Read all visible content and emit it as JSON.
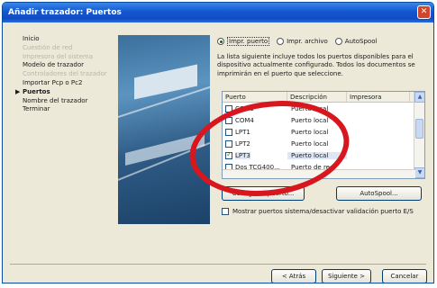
{
  "window": {
    "title": "Añadir trazador: Puertos",
    "close_glyph": "✕"
  },
  "steps": [
    {
      "label": "Inicio",
      "state": "normal"
    },
    {
      "label": "Cuestión de red",
      "state": "dim"
    },
    {
      "label": "Impresora del sistema",
      "state": "dim"
    },
    {
      "label": "Modelo de trazador",
      "state": "normal"
    },
    {
      "label": "Controladores del trazador",
      "state": "dim"
    },
    {
      "label": "Importar Pcp o Pc2",
      "state": "normal"
    },
    {
      "label": "Puertos",
      "state": "current"
    },
    {
      "label": "Nombre del trazador",
      "state": "normal"
    },
    {
      "label": "Terminar",
      "state": "normal"
    }
  ],
  "current_arrow": "▶",
  "radios": [
    {
      "label": "Impr. puerto",
      "selected": true
    },
    {
      "label": "Impr. archivo",
      "selected": false
    },
    {
      "label": "AutoSpool",
      "selected": false
    }
  ],
  "description": "La lista siguiente incluye todos los puertos disponibles para el dispositivo actualmente configurado. Todos los documentos se imprimirán en el puerto que seleccione.",
  "table": {
    "headers": [
      "Puerto",
      "Descripción",
      "Impresora"
    ],
    "rows": [
      {
        "port": "COM3",
        "desc": "Puerto local",
        "checked": false
      },
      {
        "port": "COM4",
        "desc": "Puerto local",
        "checked": false
      },
      {
        "port": "LPT1",
        "desc": "Puerto local",
        "checked": false
      },
      {
        "port": "LPT2",
        "desc": "Puerto local",
        "checked": false
      },
      {
        "port": "LPT3",
        "desc": "Puerto local",
        "checked": true
      },
      {
        "port": "Dos TCG400...",
        "desc": "Puerto de red",
        "checked": false
      }
    ],
    "scroll_up": "▲",
    "scroll_down": "▼"
  },
  "buttons": {
    "configure": "Configurar puerto...",
    "autospool": "AutoSpool...",
    "back": "< Atrás",
    "next": "Siguiente >",
    "cancel": "Cancelar"
  },
  "show_all_ports_checkbox": {
    "label": "Mostrar puertos sistema/desactivar validación puerto E/S",
    "checked": false
  },
  "colors": {
    "titlebar": "#1457d0",
    "highlight_ellipse": "#d8161e"
  }
}
